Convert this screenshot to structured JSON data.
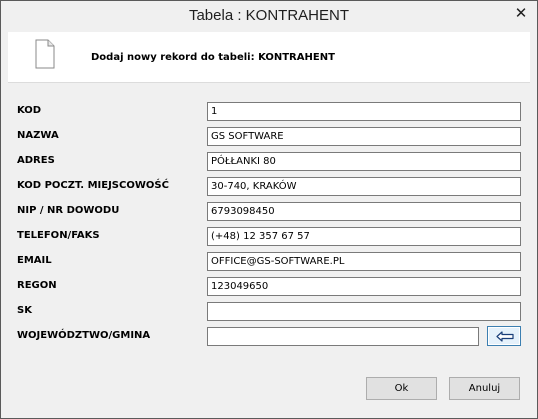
{
  "window": {
    "title": "Tabela : KONTRAHENT",
    "close_glyph": "✕"
  },
  "header": {
    "icon": "document-icon",
    "title": "Dodaj nowy rekord do tabeli:  KONTRAHENT"
  },
  "form": {
    "fields": [
      {
        "label": "KOD",
        "value": "1"
      },
      {
        "label": "NAZWA",
        "value": "GS SOFTWARE"
      },
      {
        "label": "ADRES",
        "value": "PÓŁŁANKI 80"
      },
      {
        "label": "KOD POCZT. MIEJSCOWOŚĆ",
        "value": "30-740, KRAKÓW"
      },
      {
        "label": "NIP / NR DOWODU",
        "value": "6793098450"
      },
      {
        "label": "TELEFON/FAKS",
        "value": "(+48) 12 357 67 57"
      },
      {
        "label": "EMAIL",
        "value": "OFFICE@GS-SOFTWARE.PL"
      },
      {
        "label": "REGON",
        "value": "123049650"
      },
      {
        "label": "SK",
        "value": ""
      },
      {
        "label": "WOJEWÓDZTWO/GMINA",
        "value": ""
      }
    ],
    "picker_icon": "arrow-left-icon"
  },
  "buttons": {
    "ok": "Ok",
    "cancel": "Anuluj"
  }
}
